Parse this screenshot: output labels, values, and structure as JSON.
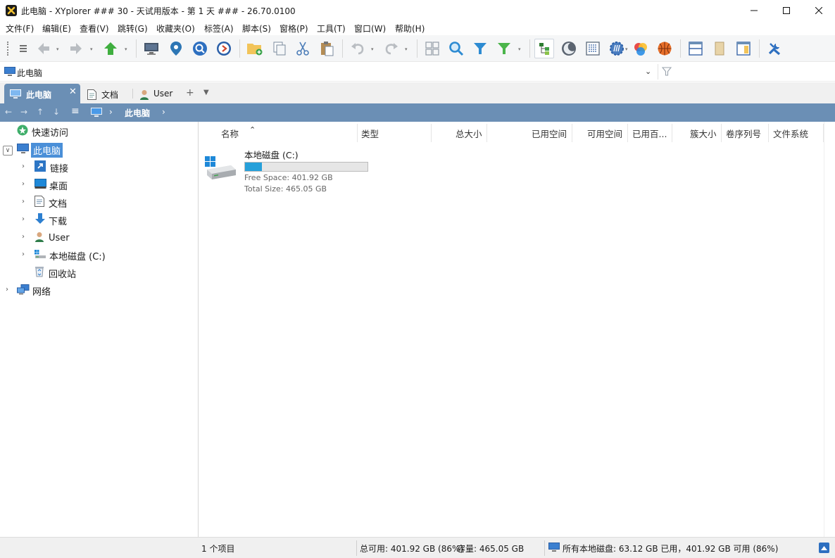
{
  "window": {
    "title": "此电脑 - XYplorer ### 30 - 天试用版本 - 第 1 天 ### - 26.70.0100"
  },
  "menu": [
    "文件(F)",
    "编辑(E)",
    "查看(V)",
    "跳转(G)",
    "收藏夹(O)",
    "标签(A)",
    "脚本(S)",
    "窗格(P)",
    "工具(T)",
    "窗口(W)",
    "帮助(H)"
  ],
  "address": {
    "path": "此电脑"
  },
  "tabs": [
    {
      "label": "此电脑",
      "icon": "computer-icon",
      "active": true
    },
    {
      "label": "文档",
      "icon": "document-icon",
      "active": false
    },
    {
      "label": "User",
      "icon": "user-icon",
      "active": false
    }
  ],
  "breadcrumb": {
    "current": "此电脑"
  },
  "tree": [
    {
      "label": "快速访问",
      "icon": "quick-access-icon",
      "level": 1,
      "expander": ""
    },
    {
      "label": "此电脑",
      "icon": "computer-icon",
      "level": 1,
      "expander": "∨",
      "selected": true
    },
    {
      "label": "链接",
      "icon": "link-icon",
      "level": 2,
      "expander": "›"
    },
    {
      "label": "桌面",
      "icon": "desktop-icon",
      "level": 2,
      "expander": "›"
    },
    {
      "label": "文档",
      "icon": "document-icon",
      "level": 2,
      "expander": "›"
    },
    {
      "label": "下载",
      "icon": "download-icon",
      "level": 2,
      "expander": "›"
    },
    {
      "label": "User",
      "icon": "user-icon",
      "level": 2,
      "expander": "›"
    },
    {
      "label": "本地磁盘 (C:)",
      "icon": "drive-icon",
      "level": 2,
      "expander": "›"
    },
    {
      "label": "回收站",
      "icon": "recycle-bin-icon",
      "level": 2,
      "expander": ""
    },
    {
      "label": "网络",
      "icon": "network-icon",
      "level": 1,
      "expander": "›"
    }
  ],
  "columns": [
    "名称",
    "类型",
    "总大小",
    "已用空间",
    "可用空间",
    "已用百...",
    "簇大小",
    "卷序列号",
    "文件系统"
  ],
  "drive": {
    "name": "本地磁盘 (C:)",
    "used_fraction": 0.14,
    "free": "Free Space: 401.92 GB",
    "total": "Total Size: 465.05 GB"
  },
  "status": {
    "items": "1 个项目",
    "free": "总可用: 401.92 GB (86%)",
    "capacity": "容量: 465.05 GB",
    "all_drives": "所有本地磁盘: 63.12 GB 已用，401.92 GB 可用 (86%)"
  },
  "colors": {
    "accent": "#6b8fb5",
    "selection": "#4a8fd8",
    "progress": "#26a0da"
  }
}
